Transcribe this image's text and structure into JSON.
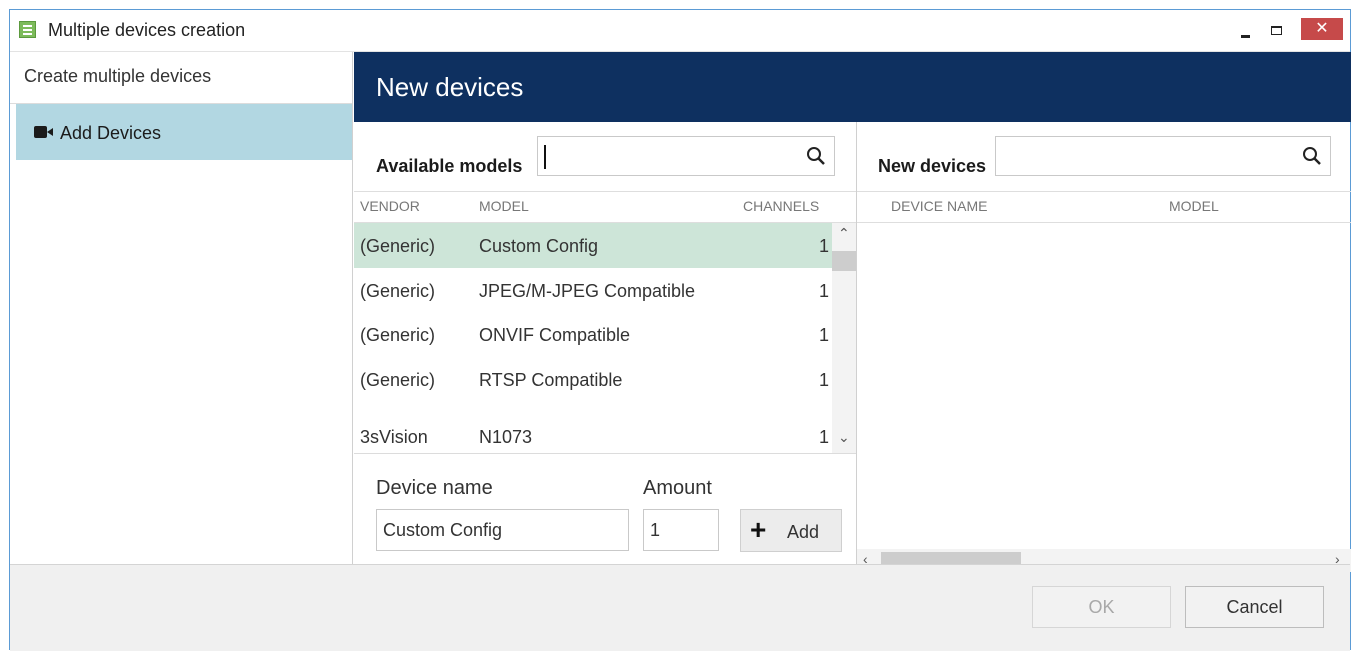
{
  "window": {
    "title": "Multiple devices creation",
    "close_symbol": "✕"
  },
  "sidebar": {
    "header": "Create multiple devices",
    "items": [
      {
        "label": "Add Devices",
        "icon": "video-camera-icon",
        "active": true
      }
    ]
  },
  "main": {
    "title": "New devices",
    "available": {
      "title": "Available models",
      "search_value": "",
      "columns": [
        "VENDOR",
        "MODEL",
        "CHANNELS"
      ],
      "rows": [
        {
          "vendor": "(Generic)",
          "model": "Custom Config",
          "channels": "1",
          "selected": true
        },
        {
          "vendor": "(Generic)",
          "model": "JPEG/M-JPEG Compatible",
          "channels": "1",
          "selected": false
        },
        {
          "vendor": "(Generic)",
          "model": "ONVIF Compatible",
          "channels": "1",
          "selected": false
        },
        {
          "vendor": "(Generic)",
          "model": "RTSP Compatible",
          "channels": "1",
          "selected": false
        },
        {
          "vendor": "3sVision",
          "model": "N1073",
          "channels": "1",
          "selected": false
        }
      ]
    },
    "new_devices": {
      "title": "New devices",
      "search_value": "",
      "columns": [
        "DEVICE NAME",
        "MODEL"
      ]
    },
    "form": {
      "device_name_label": "Device name",
      "device_name_value": "Custom Config",
      "amount_label": "Amount",
      "amount_value": "1",
      "add_label": "Add",
      "add_symbol": "+"
    }
  },
  "footer": {
    "ok_label": "OK",
    "cancel_label": "Cancel"
  },
  "colors": {
    "header_bg": "#0e3060",
    "sidebar_active_bg": "#b2d7e2",
    "row_selected_bg": "#cde5d8",
    "close_button_bg": "#c64a4a"
  }
}
